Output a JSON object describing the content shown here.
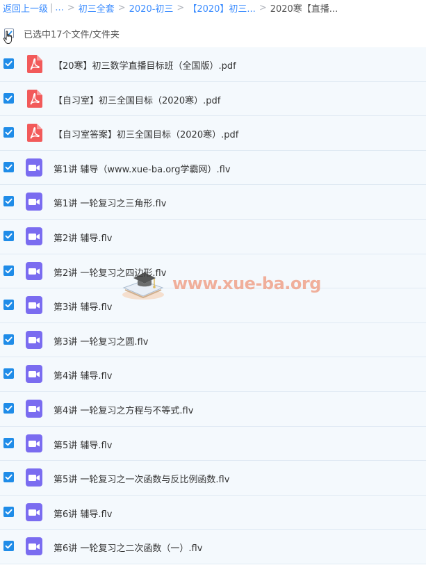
{
  "breadcrumb": {
    "back": "返回上一级",
    "sep1": "|",
    "ellipsis": "...",
    "sep": ">",
    "crumb1": "初三全套",
    "crumb2": "2020-初三",
    "crumb3": "【2020】初三...",
    "current": "2020寒【直播..."
  },
  "selection": {
    "label": "已选中17个文件/文件夹"
  },
  "files": [
    {
      "name": "【20寒】初三数学直播目标班（全国版）.pdf",
      "type": "pdf"
    },
    {
      "name": "【自习室】初三全国目标（2020寒）.pdf",
      "type": "pdf"
    },
    {
      "name": "【自习室答案】初三全国目标（2020寒）.pdf",
      "type": "pdf"
    },
    {
      "name": "第1讲 辅导（www.xue-ba.org学霸网）.flv",
      "type": "video"
    },
    {
      "name": "第1讲 一轮复习之三角形.flv",
      "type": "video"
    },
    {
      "name": "第2讲 辅导.flv",
      "type": "video"
    },
    {
      "name": "第2讲 一轮复习之四边形.flv",
      "type": "video"
    },
    {
      "name": "第3讲 辅导.flv",
      "type": "video"
    },
    {
      "name": "第3讲 一轮复习之圆.flv",
      "type": "video"
    },
    {
      "name": "第4讲 辅导.flv",
      "type": "video"
    },
    {
      "name": "第4讲 一轮复习之方程与不等式.flv",
      "type": "video"
    },
    {
      "name": "第5讲 辅导.flv",
      "type": "video"
    },
    {
      "name": "第5讲 一轮复习之一次函数与反比例函数.flv",
      "type": "video"
    },
    {
      "name": "第6讲 辅导.flv",
      "type": "video"
    },
    {
      "name": "第6讲 一轮复习之二次函数（一）.flv",
      "type": "video"
    }
  ],
  "watermark": {
    "text": "www.xue-ba.org"
  },
  "colors": {
    "link": "#3b8cff",
    "checkbox": "#1f8ce8",
    "pdf_icon": "#f25a5a",
    "video_icon": "#7a6cf0",
    "row_bg": "#f4f9fd"
  },
  "icons": {
    "pdf": "pdf-file-icon",
    "video": "video-file-icon",
    "check": "checkmark-icon",
    "cursor": "hand-cursor-icon"
  }
}
